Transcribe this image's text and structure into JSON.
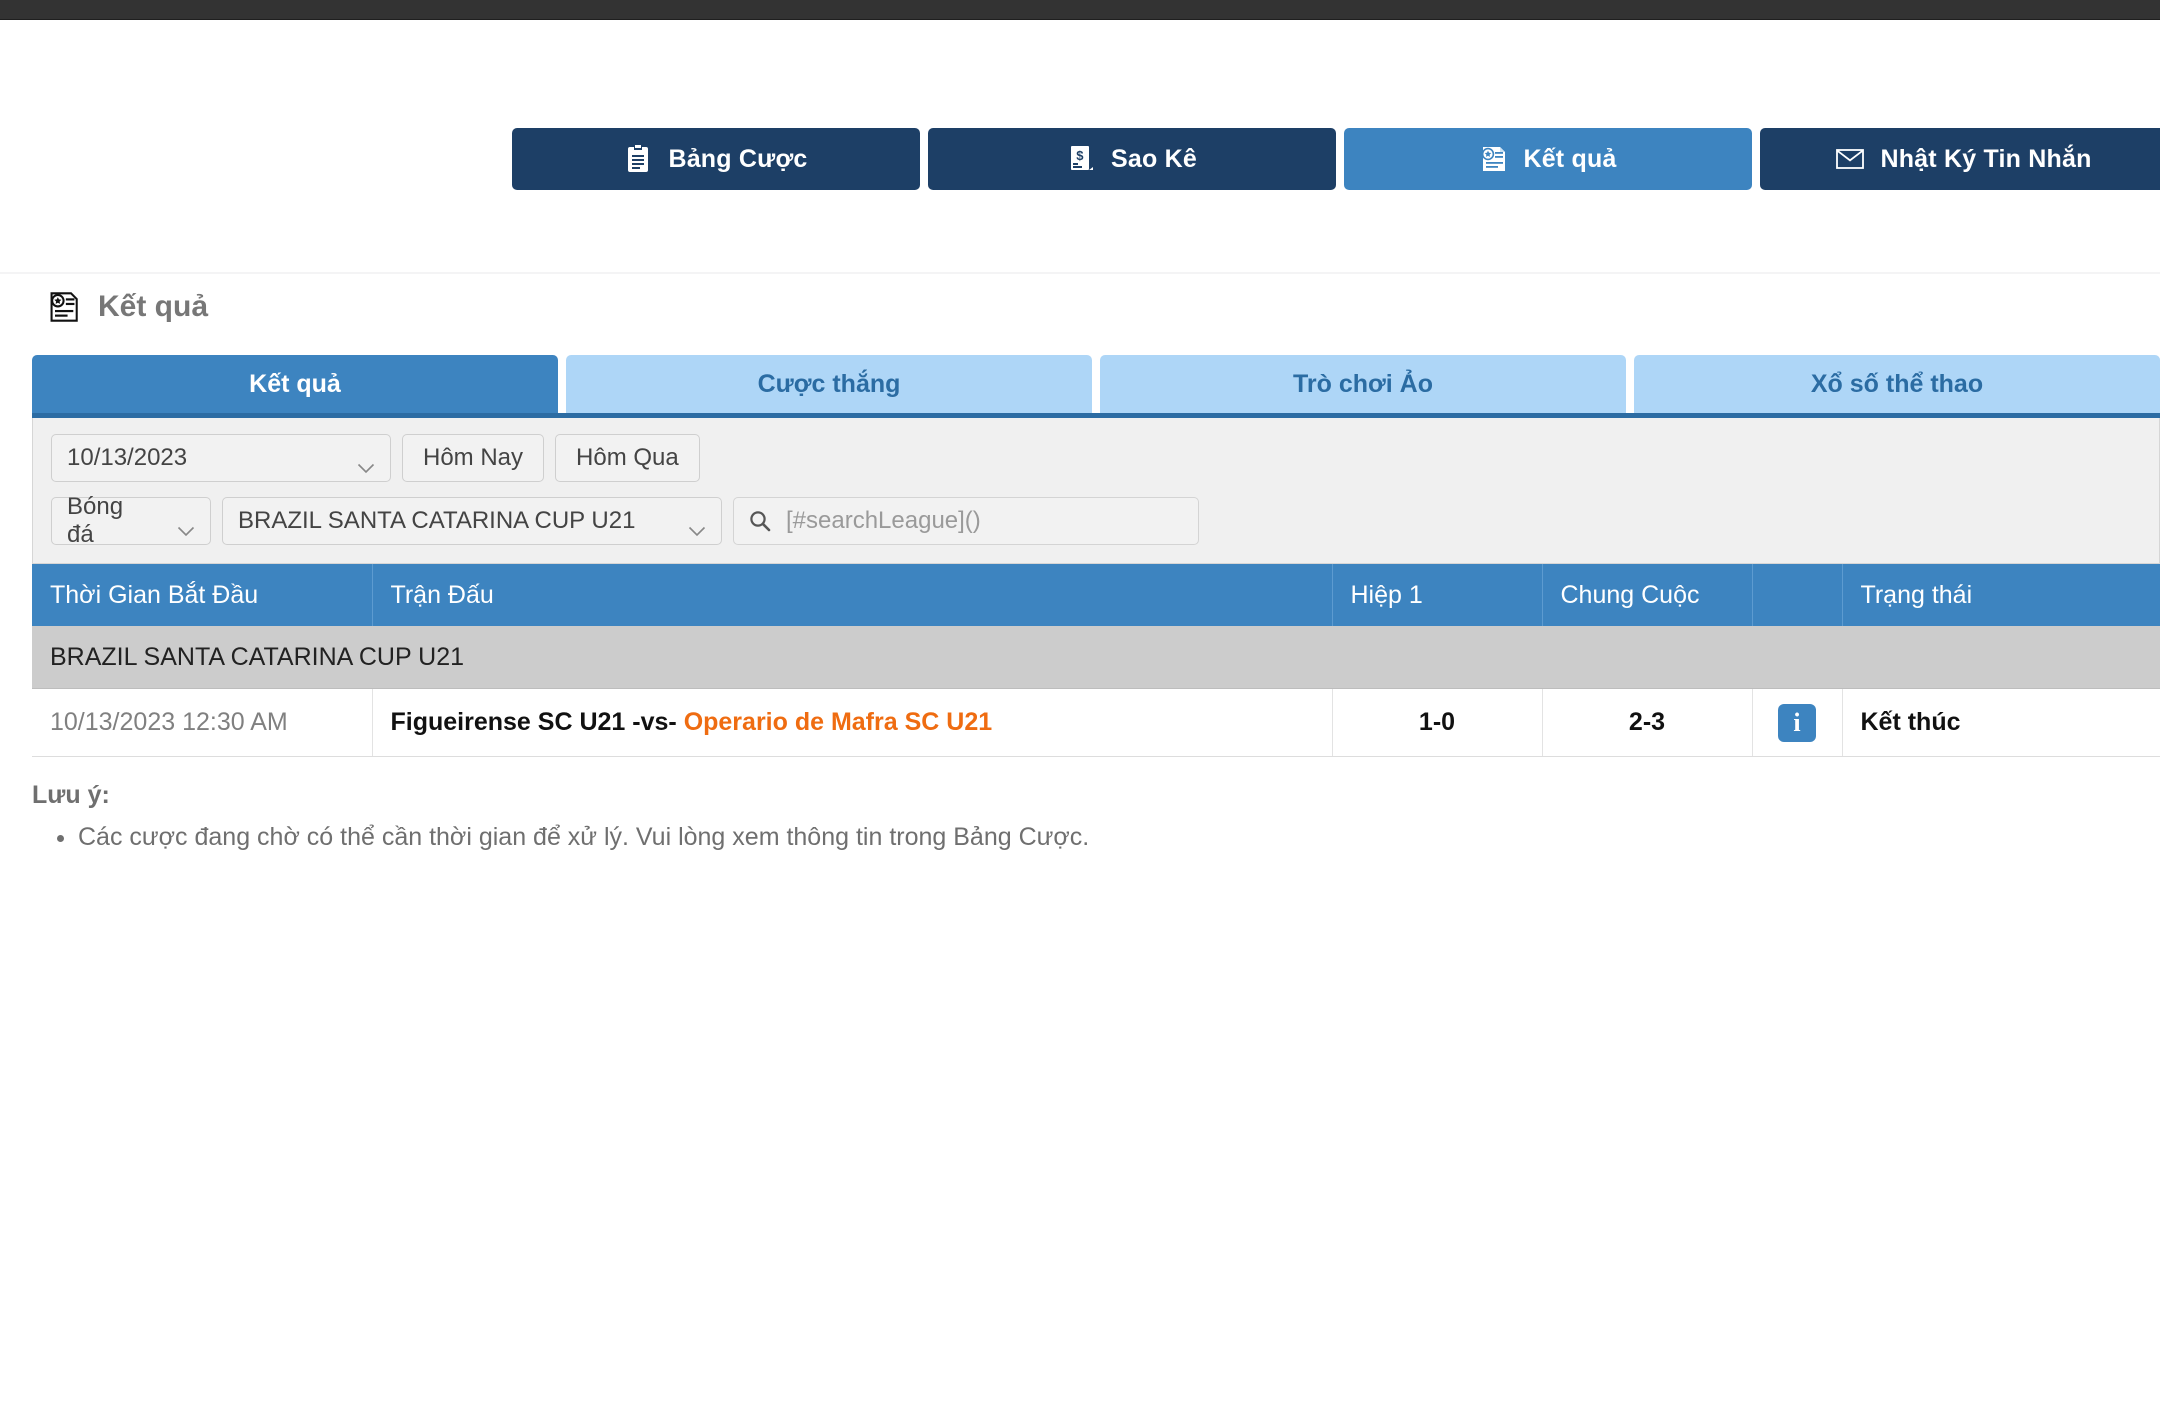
{
  "topnav": {
    "buttons": [
      {
        "label": "Bảng Cược",
        "icon": "clipboard-icon",
        "active": false
      },
      {
        "label": "Sao Kê",
        "icon": "statement-icon",
        "active": false
      },
      {
        "label": "Kết quả",
        "icon": "results-icon",
        "active": true
      },
      {
        "label": "Nhật Ký Tin Nhắn",
        "icon": "envelope-icon",
        "active": false
      }
    ]
  },
  "page": {
    "title": "Kết quả",
    "title_icon": "results-icon"
  },
  "tabs": [
    {
      "label": "Kết quả",
      "active": true
    },
    {
      "label": "Cược thắng",
      "active": false
    },
    {
      "label": "Trò chơi Ảo",
      "active": false
    },
    {
      "label": "Xổ số thể thao",
      "active": false
    }
  ],
  "filters": {
    "date_value": "10/13/2023",
    "today_label": "Hôm Nay",
    "yesterday_label": "Hôm Qua",
    "sport_value": "Bóng đá",
    "league_value": "BRAZIL SANTA CATARINA CUP U21",
    "search_placeholder": "[#searchLeague]()",
    "search_value": "",
    "search_icon": "search-icon"
  },
  "table": {
    "headers": {
      "time": "Thời Gian Bắt Đầu",
      "match": "Trận Đấu",
      "half": "Hiệp 1",
      "full": "Chung Cuộc",
      "info": "",
      "state": "Trạng thái"
    },
    "league_group": "BRAZIL SANTA CATARINA CUP U21",
    "rows": [
      {
        "time": "10/13/2023 12:30 AM",
        "home": "Figueirense SC U21",
        "vs": "-vs-",
        "away": "Operario de Mafra SC U21",
        "half": "1-0",
        "full": "2-3",
        "info_icon": "info-icon",
        "state": "Kết thúc"
      }
    ]
  },
  "notes": {
    "heading": "Lưu ý:",
    "items": [
      "Các cược đang chờ có thể cần thời gian để xử lý. Vui lòng xem thông tin trong Bảng Cược."
    ]
  },
  "colors": {
    "navy": "#1d3f66",
    "blue": "#3d84c0",
    "light_blue": "#aed6f7",
    "orange": "#ef6c11",
    "gray_group": "#cccccc"
  }
}
